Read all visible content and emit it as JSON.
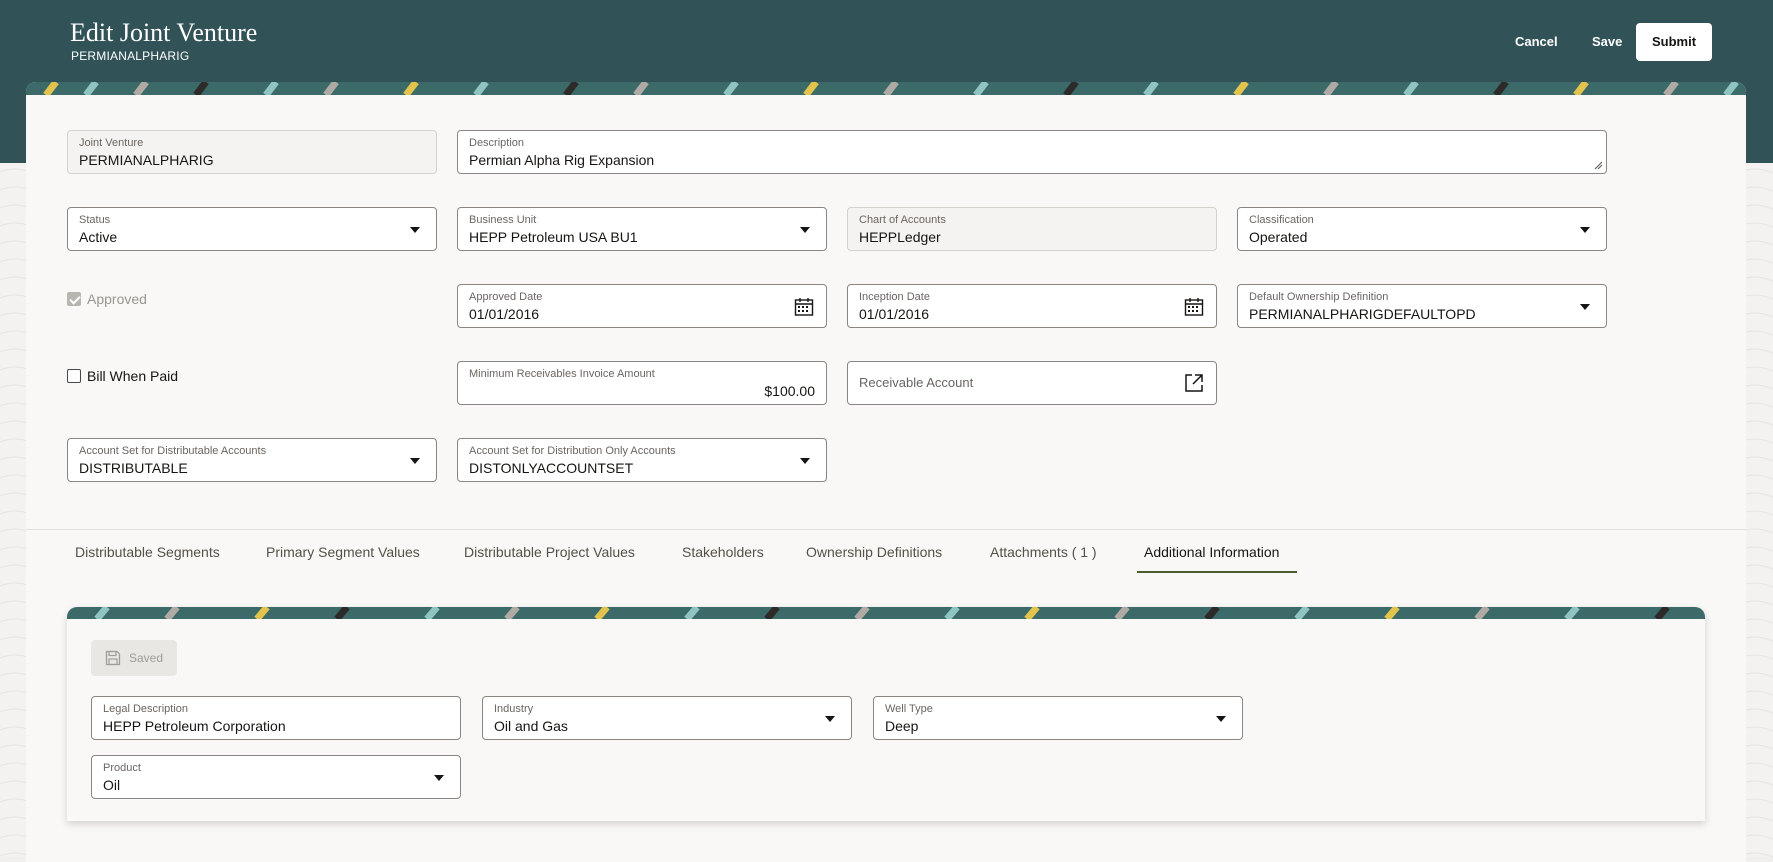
{
  "header": {
    "title": "Edit Joint Venture",
    "subtitle": "PERMIANALPHARIG",
    "cancel_label": "Cancel",
    "save_label": "Save",
    "submit_label": "Submit"
  },
  "form": {
    "joint_venture": {
      "label": "Joint Venture",
      "value": "PERMIANALPHARIG"
    },
    "description": {
      "label": "Description",
      "value": "Permian Alpha Rig Expansion"
    },
    "status": {
      "label": "Status",
      "value": "Active"
    },
    "business_unit": {
      "label": "Business Unit",
      "value": "HEPP Petroleum USA BU1"
    },
    "chart_of_accounts": {
      "label": "Chart of Accounts",
      "value": "HEPPLedger"
    },
    "classification": {
      "label": "Classification",
      "value": "Operated"
    },
    "approved": {
      "label": "Approved",
      "checked": true
    },
    "approved_date": {
      "label": "Approved Date",
      "value": "01/01/2016"
    },
    "inception_date": {
      "label": "Inception Date",
      "value": "01/01/2016"
    },
    "default_ownership": {
      "label": "Default Ownership Definition",
      "value": "PERMIANALPHARIGDEFAULTOPD"
    },
    "bill_when_paid": {
      "label": "Bill When Paid",
      "checked": false
    },
    "min_receivables": {
      "label": "Minimum Receivables Invoice Amount",
      "value": "$100.00"
    },
    "receivable_account": {
      "placeholder": "Receivable Account"
    },
    "account_set_distributable": {
      "label": "Account Set for Distributable Accounts",
      "value": "DISTRIBUTABLE"
    },
    "account_set_distribution_only": {
      "label": "Account Set for Distribution Only Accounts",
      "value": "DISTONLYACCOUNTSET"
    }
  },
  "tabs": [
    {
      "label": "Distributable Segments"
    },
    {
      "label": "Primary Segment Values"
    },
    {
      "label": "Distributable Project Values"
    },
    {
      "label": "Stakeholders"
    },
    {
      "label": "Ownership Definitions"
    },
    {
      "label": "Attachments ( 1 )"
    },
    {
      "label": "Additional Information",
      "active": true
    }
  ],
  "additional_info": {
    "saved_label": "Saved",
    "legal_description": {
      "label": "Legal Description",
      "value": "HEPP Petroleum Corporation"
    },
    "industry": {
      "label": "Industry",
      "value": "Oil and Gas"
    },
    "well_type": {
      "label": "Well Type",
      "value": "Deep"
    },
    "product": {
      "label": "Product",
      "value": "Oil"
    }
  },
  "colors": {
    "header_bg": "#315357",
    "card_bg": "#f9f8f6",
    "tab_active_underline": "#4b5d31"
  },
  "icons": [
    "calendar-icon",
    "external-link-icon",
    "save-disk-icon",
    "dropdown-caret-icon"
  ]
}
